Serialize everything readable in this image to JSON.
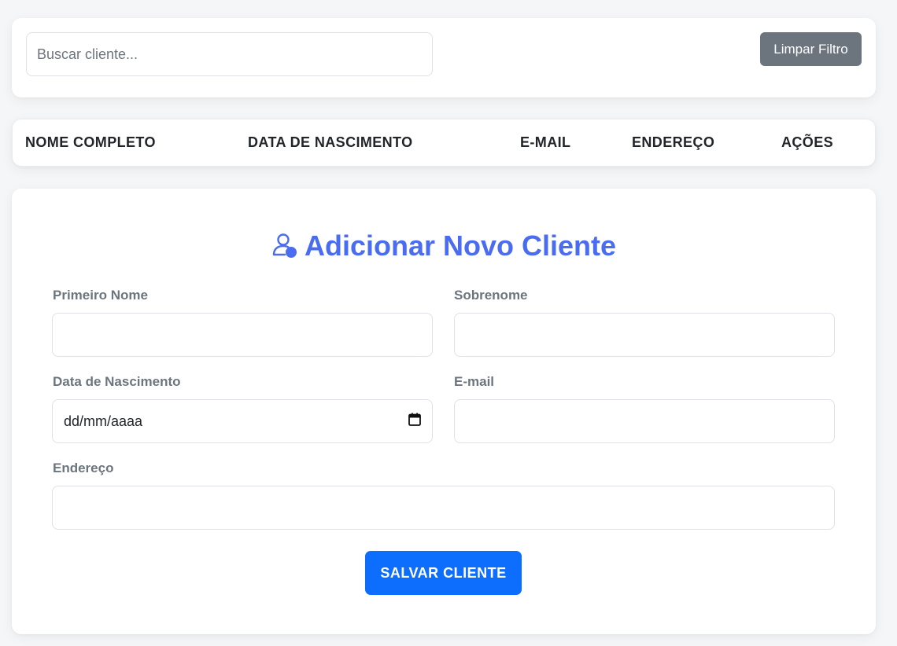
{
  "filter": {
    "search_placeholder": "Buscar cliente...",
    "clear_label": "Limpar Filtro"
  },
  "table": {
    "headers": [
      "NOME COMPLETO",
      "DATA DE NASCIMENTO",
      "E-MAIL",
      "ENDEREÇO",
      "AÇÕES"
    ]
  },
  "form": {
    "title": "Adicionar Novo Cliente",
    "title_icon": "user-add-icon",
    "first_name_label": "Primeiro Nome",
    "last_name_label": "Sobrenome",
    "birth_date_label": "Data de Nascimento",
    "birth_date_placeholder": "dd/mm/aaaa",
    "email_label": "E-mail",
    "address_label": "Endereço",
    "save_label": "SALVAR CLIENTE"
  },
  "colors": {
    "accent": "#4a6cf0",
    "primary_button": "#0d6efd",
    "secondary_button": "#6c757d",
    "background": "#f5f6f8"
  }
}
